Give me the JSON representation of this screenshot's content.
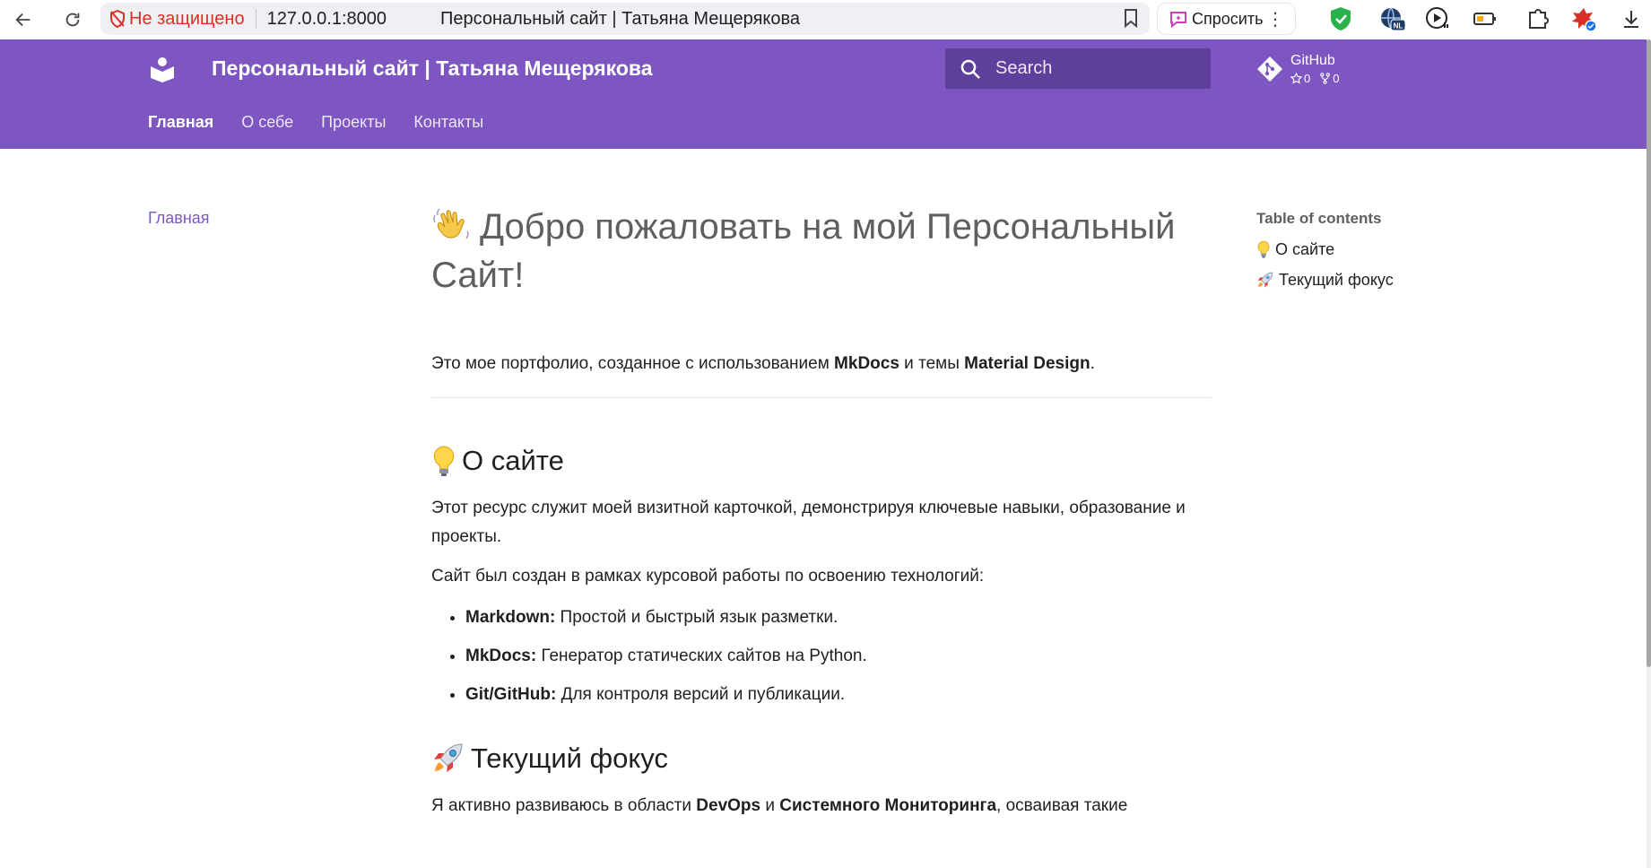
{
  "browser": {
    "security_label": "Не защищено",
    "url": "127.0.0.1:8000",
    "tab_title": "Персональный сайт | Татьяна Мещерякова",
    "ask_label": "Спросить"
  },
  "header": {
    "site_title": "Персональный сайт | Татьяна Мещерякова",
    "search_placeholder": "Search",
    "repo": {
      "name": "GitHub",
      "stars": "0",
      "forks": "0"
    },
    "tabs": [
      {
        "label": "Главная",
        "active": true
      },
      {
        "label": "О себе",
        "active": false
      },
      {
        "label": "Проекты",
        "active": false
      },
      {
        "label": "Контакты",
        "active": false
      }
    ]
  },
  "nav": {
    "home": "Главная"
  },
  "toc": {
    "title": "Table of contents",
    "items": [
      {
        "label": "О сайте",
        "icon": "lightbulb-icon"
      },
      {
        "label": "Текущий фокус",
        "icon": "rocket-icon"
      }
    ]
  },
  "content": {
    "heading": "Добро пожаловать на мой Персональный Сайт!",
    "intro": {
      "p1": "Это мое портфолио, созданное с использованием ",
      "b1": "MkDocs",
      "p2": " и темы ",
      "b2": "Material Design",
      "p3": "."
    },
    "section1": {
      "title": "О сайте",
      "p1": "Этот ресурс служит моей визитной карточкой, демонстрируя ключевые навыки, образование и проекты.",
      "p2": "Сайт был создан в рамках курсовой работы по освоению технологий:",
      "list": [
        {
          "term": "Markdown:",
          "desc": " Простой и быстрый язык разметки."
        },
        {
          "term": "MkDocs:",
          "desc": " Генератор статических сайтов на Python."
        },
        {
          "term": "Git/GitHub:",
          "desc": " Для контроля версий и публикации."
        }
      ]
    },
    "section2": {
      "title": "Текущий фокус",
      "p1a": "Я активно развиваюсь в области ",
      "b1": "DevOps",
      "p1b": " и ",
      "b2": "Системного Мониторинга",
      "p1c": ", осваивая такие"
    }
  },
  "colors": {
    "primary": "#7e56c2",
    "search_bg": "#5e3f9c",
    "insecure": "#d93025"
  }
}
